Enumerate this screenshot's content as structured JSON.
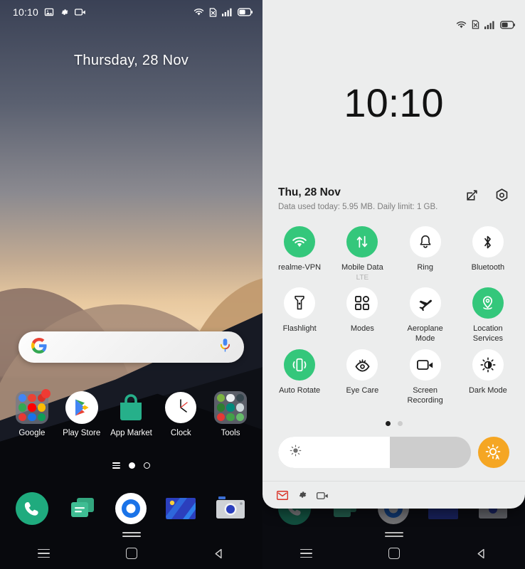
{
  "home": {
    "status_bar": {
      "time": "10:10",
      "left_icons": [
        "photo-icon",
        "gear-icon",
        "screen-recorder-icon"
      ],
      "right_icons": [
        "wifi-icon",
        "sim-alert-icon",
        "signal-bars-icon",
        "battery-icon"
      ]
    },
    "date_widget": "Thursday, 28 Nov",
    "search_bar": {
      "left_icon": "google-logo-icon",
      "right_icon": "microphone-icon",
      "placeholder": ""
    },
    "apps": [
      {
        "label": "Google",
        "icon": "google-folder-icon",
        "badge": true
      },
      {
        "label": "Play Store",
        "icon": "play-store-icon",
        "badge": false
      },
      {
        "label": "App Market",
        "icon": "app-market-icon",
        "badge": false
      },
      {
        "label": "Clock",
        "icon": "clock-icon",
        "badge": false
      },
      {
        "label": "Tools",
        "icon": "tools-folder-icon",
        "badge": false
      }
    ],
    "dock": [
      {
        "label": "Phone",
        "icon": "phone-icon"
      },
      {
        "label": "Messages",
        "icon": "messages-icon"
      },
      {
        "label": "Browser",
        "icon": "browser-icon"
      },
      {
        "label": "Photos",
        "icon": "photos-icon"
      },
      {
        "label": "Camera",
        "icon": "camera-icon"
      }
    ],
    "page_indicator": {
      "pages": 3,
      "active_index": 1
    },
    "nav_bar": [
      "recents-icon",
      "home-icon",
      "back-icon"
    ]
  },
  "quick_settings": {
    "status_bar": {
      "right_icons": [
        "wifi-icon",
        "sim-alert-icon",
        "signal-bars-icon",
        "battery-icon"
      ]
    },
    "clock": "10:10",
    "date": "Thu, 28 Nov",
    "data_usage": "Data used today: 5.95 MB. Daily limit: 1 GB.",
    "header_actions": [
      {
        "name": "edit-tiles-button",
        "icon": "edit-pencil-icon"
      },
      {
        "name": "settings-button",
        "icon": "gear-hex-icon"
      }
    ],
    "tiles": [
      {
        "label": "realme-VPN",
        "icon": "wifi-icon",
        "active": true,
        "sub": ""
      },
      {
        "label": "Mobile Data",
        "icon": "data-arrows-icon",
        "active": true,
        "sub": "LTE"
      },
      {
        "label": "Ring",
        "icon": "bell-icon",
        "active": false,
        "sub": ""
      },
      {
        "label": "Bluetooth",
        "icon": "bluetooth-icon",
        "active": false,
        "sub": ""
      },
      {
        "label": "Flashlight",
        "icon": "flashlight-icon",
        "active": false,
        "sub": ""
      },
      {
        "label": "Modes",
        "icon": "grid-squares-icon",
        "active": false,
        "sub": ""
      },
      {
        "label": "Aeroplane Mode",
        "icon": "airplane-icon",
        "active": false,
        "sub": ""
      },
      {
        "label": "Location Services",
        "icon": "location-pin-icon",
        "active": true,
        "sub": ""
      },
      {
        "label": "Auto Rotate",
        "icon": "auto-rotate-icon",
        "active": true,
        "sub": ""
      },
      {
        "label": "Eye Care",
        "icon": "eye-icon",
        "active": false,
        "sub": ""
      },
      {
        "label": "Screen Recording",
        "icon": "screen-recorder-icon",
        "active": false,
        "sub": ""
      },
      {
        "label": "Dark Mode",
        "icon": "brightness-half-icon",
        "active": false,
        "sub": ""
      }
    ],
    "tile_pages": {
      "pages": 2,
      "active_index": 0
    },
    "brightness": {
      "level_percent": 58,
      "slider_icon": "brightness-icon",
      "auto_button_icon": "auto-brightness-icon"
    },
    "footer_icons": [
      "gmail-icon",
      "gear-icon",
      "screen-recorder-icon"
    ],
    "nav_bar": [
      "recents-icon",
      "home-icon",
      "back-icon"
    ]
  },
  "colors": {
    "accent_green": "#34c77b",
    "accent_orange": "#f5a623",
    "panel_bg": "#eceded",
    "badge_red": "#ef3b34",
    "text_primary": "#1c1c1c",
    "text_secondary": "#7e7e7e"
  }
}
